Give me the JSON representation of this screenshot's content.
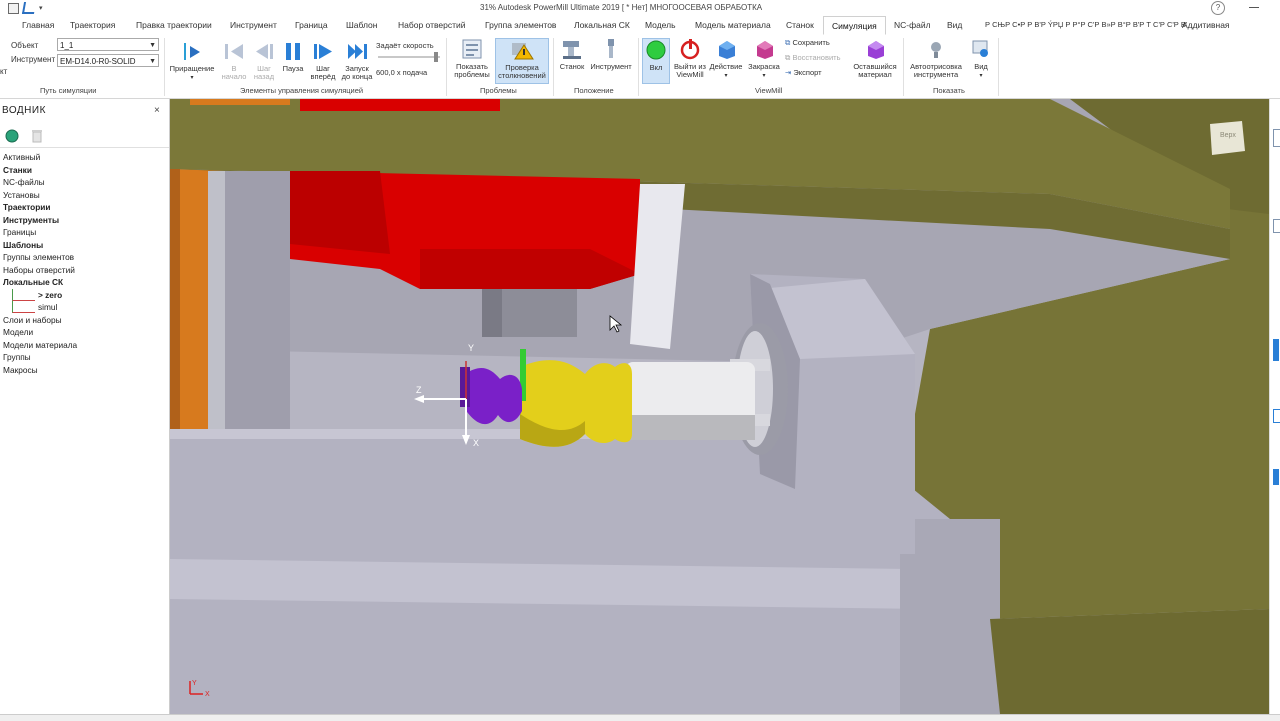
{
  "title": "31% Autodesk PowerMill Ultimate 2019    [ * Нет]    МНОГООСЕВАЯ ОБРАБОТКА",
  "tabs": [
    "Главная",
    "Траектория",
    "Правка траектории",
    "Инструмент",
    "Граница",
    "Шаблон",
    "Набор отверстий",
    "Группа элементов",
    "Локальная СК",
    "Модель",
    "Модель материала",
    "Станок",
    "Симуляция",
    "NC-файл",
    "Вид",
    "Р СЊР С•Р Р В'Р ÝРЏ Р Р°Р С'Р В»Р В°Р В'Р Т С'Р С'Р В'",
    "Аддитивная"
  ],
  "active_tab": "Симуляция",
  "ribbon": {
    "object_label": "Объект",
    "object_value": "1_1",
    "tool_label": "Инструмент",
    "tool_value": "EM-D14.0-R0-SOLID",
    "partial_label": "кт",
    "increment": "Приращение",
    "to_start": "В начало",
    "step_back": "Шаг назад",
    "pause": "Пауза",
    "step_forward": "Шаг вперёд",
    "run_to_end": "Запуск до конца",
    "speed_label": "Задаёт скорость",
    "feed_value": "600,0 х подача",
    "show_problems": "Показать проблемы",
    "collision_check": "Проверка столкновений",
    "machine": "Станок",
    "tool": "Инструмент",
    "on": "Вкл",
    "exit_viewmill": "Выйти из ViewMill",
    "action": "Действие",
    "shading": "Закраска",
    "save": "Сохранить",
    "restore": "Восстановить",
    "export": "Экспорт",
    "remaining_material": "Оставшийся материал",
    "autodraw_tool": "Автоотрисовка инструмента",
    "view": "Вид",
    "groups": {
      "sim_path": "Путь симуляции",
      "sim_controls": "Элементы управления симуляцией",
      "problems": "Проблемы",
      "position": "Положение",
      "viewmill": "ViewMill",
      "show": "Показать"
    }
  },
  "explorer": {
    "title": "ВОДНИК",
    "close": "×",
    "items": [
      {
        "label": "Активный",
        "bold": false
      },
      {
        "label": "Станки",
        "bold": true
      },
      {
        "label": "NC-файлы",
        "bold": false
      },
      {
        "label": "Установы",
        "bold": false
      },
      {
        "label": "Траектории",
        "bold": true
      },
      {
        "label": "Инструменты",
        "bold": true
      },
      {
        "label": "Границы",
        "bold": false
      },
      {
        "label": "Шаблоны",
        "bold": true
      },
      {
        "label": "Группы элементов",
        "bold": false
      },
      {
        "label": "Наборы отверстий",
        "bold": false
      },
      {
        "label": "Локальные СК",
        "bold": true
      },
      {
        "label": "> zero",
        "bold": true,
        "indent": true
      },
      {
        "label": "simul",
        "bold": false,
        "indent": true
      },
      {
        "label": "Слои и наборы",
        "bold": false
      },
      {
        "label": "Модели",
        "bold": false
      },
      {
        "label": "Модели материала",
        "bold": false
      },
      {
        "label": "Группы",
        "bold": false
      },
      {
        "label": "Макросы",
        "bold": false
      }
    ]
  },
  "viewport": {
    "viewcube_label": "Верх",
    "axis_y": "Y",
    "axis_z": "Z",
    "axis_x": "X",
    "triad_y": "Y",
    "triad_x": "X"
  },
  "colors": {
    "accent": "#0078d7",
    "spindle_red": "#e00000",
    "wall_olive": "#7d7d3a",
    "machine_gray": "#b5b4c0",
    "workpiece_yellow": "#e6d21f",
    "purple": "#7a20c8"
  }
}
